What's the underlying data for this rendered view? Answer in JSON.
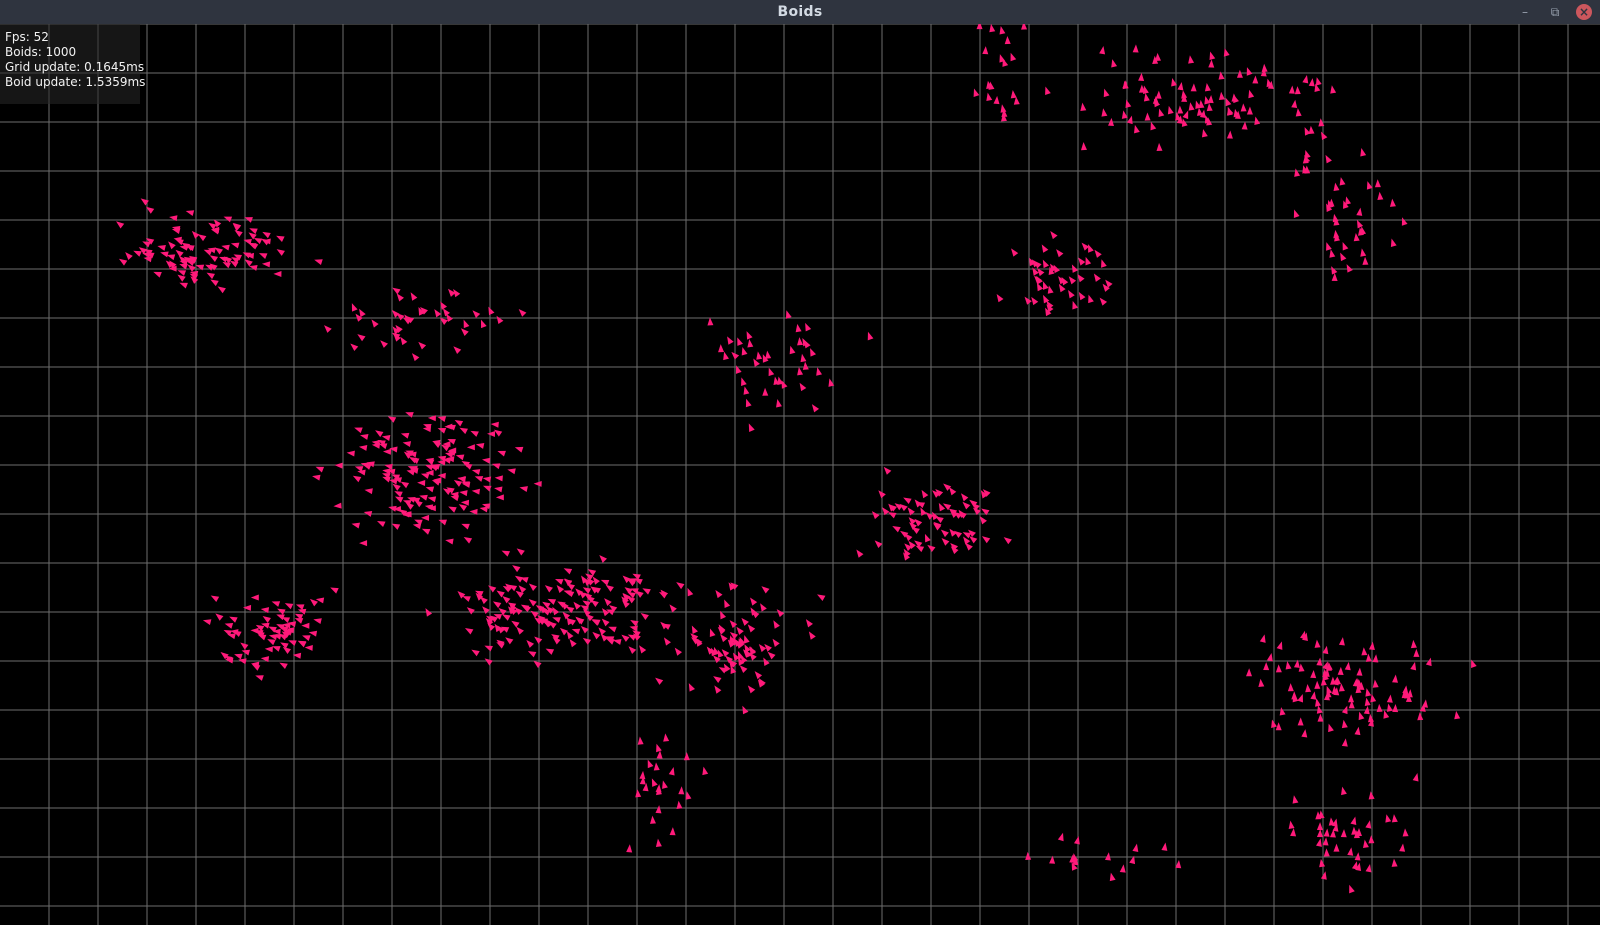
{
  "window": {
    "title": "Boids",
    "minimize_icon": "minimize-icon",
    "restore_icon": "restore-icon",
    "close_icon": "close-icon"
  },
  "stats": {
    "fps": "Fps: 52",
    "boids": "Boids: 1000",
    "grid_update": "Grid update: 0.1645ms",
    "boid_update": "Boid update: 1.5359ms"
  },
  "colors": {
    "background": "#000000",
    "grid": "#6e6e6e",
    "boid": "#ff1a7a",
    "titlebar": "#2f343f",
    "close": "#cc575d"
  },
  "simulation": {
    "boid_count": 1000,
    "grid_visible": true
  }
}
